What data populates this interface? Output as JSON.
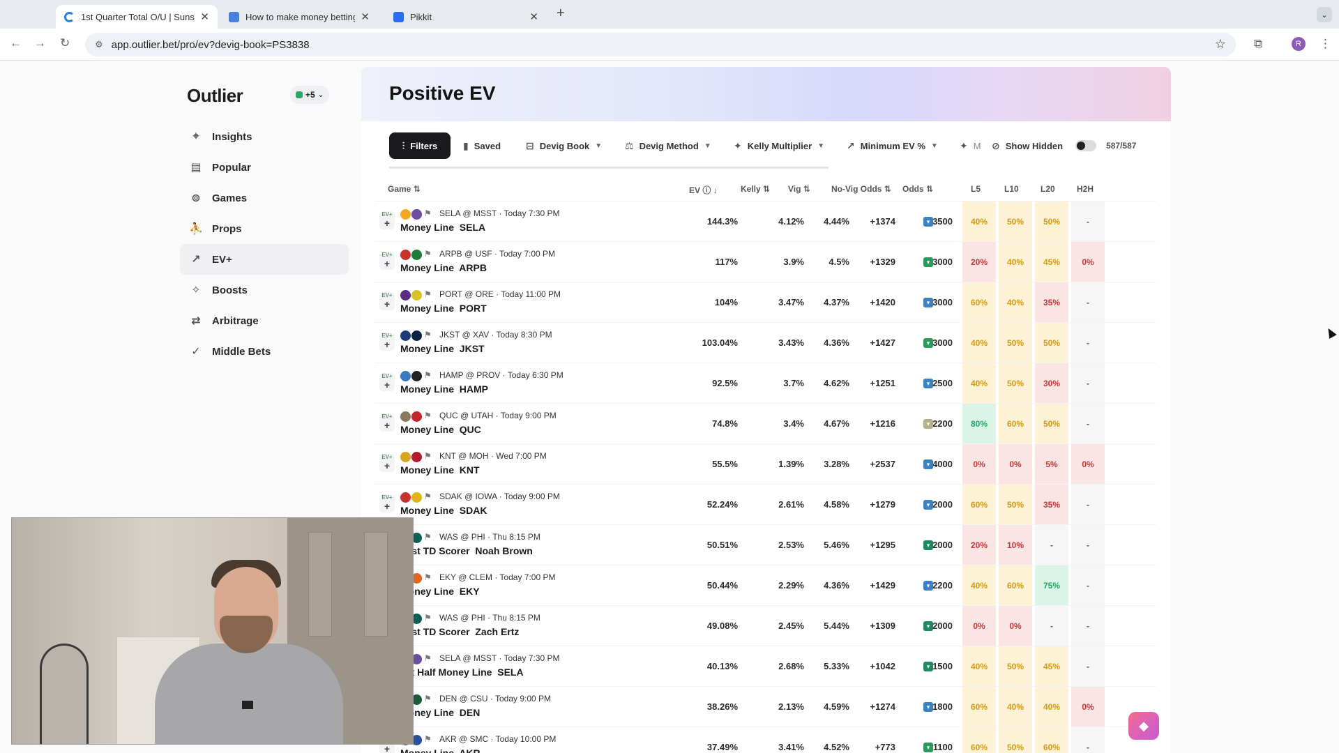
{
  "browser": {
    "tabs": [
      {
        "title": "1st Quarter Total O/U | Suns",
        "icon_color": "#2a7de1",
        "active": true
      },
      {
        "title": "How to make money betting",
        "icon_color": "#4a7fe0",
        "active": false
      },
      {
        "title": "Pikkit",
        "icon_color": "#2b6cf0",
        "active": false
      }
    ],
    "url": "app.outlier.bet/pro/ev?devig-book=PS3838",
    "profile_initial": "R"
  },
  "sidebar": {
    "logo": "Outlier",
    "books_chip": "+5",
    "items": [
      {
        "label": "Insights",
        "icon": "map-pin-icon",
        "glyph": "⌖"
      },
      {
        "label": "Popular",
        "icon": "chart-icon",
        "glyph": "▤"
      },
      {
        "label": "Games",
        "icon": "ball-icon",
        "glyph": "⊚"
      },
      {
        "label": "Props",
        "icon": "player-icon",
        "glyph": "⛹"
      },
      {
        "label": "EV+",
        "icon": "ev-icon",
        "glyph": "↗"
      },
      {
        "label": "Boosts",
        "icon": "rocket-icon",
        "glyph": "✧"
      },
      {
        "label": "Arbitrage",
        "icon": "arbitrage-icon",
        "glyph": "⇄"
      },
      {
        "label": "Middle Bets",
        "icon": "middle-icon",
        "glyph": "✓"
      }
    ]
  },
  "page": {
    "title": "Positive EV",
    "controls": {
      "filters": "Filters",
      "saved": "Saved",
      "devig_book": "Devig Book",
      "devig_method": "Devig Method",
      "kelly": "Kelly Multiplier",
      "min_ev": "Minimum EV %",
      "cut_label": "M",
      "show_hidden": "Show Hidden",
      "count": "587/587"
    },
    "columns": {
      "game": "Game",
      "ev": "EV",
      "kelly": "Kelly",
      "vig": "Vig",
      "novig": "No-Vig Odds",
      "odds": "Odds",
      "l5": "L5",
      "l10": "L10",
      "l20": "L20",
      "h2h": "H2H"
    }
  },
  "rows": [
    {
      "ev_tag": "EV+",
      "matchup": "SELA @ MSST · Today 7:30 PM",
      "market": "Money Line",
      "pick": "SELA",
      "ev": "144.3%",
      "kelly": "4.12%",
      "vig": "4.44%",
      "novig": "+1374",
      "odds": "+3500",
      "book": "#3b82c4",
      "l5": "40%",
      "l10": "50%",
      "l20": "50%",
      "h2h": "-",
      "c1": "#f6a623",
      "c2": "#6b4ea0"
    },
    {
      "ev_tag": "EV+",
      "matchup": "ARPB @ USF · Today 7:00 PM",
      "market": "Money Line",
      "pick": "ARPB",
      "ev": "117%",
      "kelly": "3.9%",
      "vig": "4.5%",
      "novig": "+1329",
      "odds": "+3000",
      "book": "#2a9b5a",
      "l5": "20%",
      "l10": "40%",
      "l20": "45%",
      "h2h": "0%",
      "c1": "#c8322d",
      "c2": "#1f7a3e"
    },
    {
      "ev_tag": "EV+",
      "matchup": "PORT @ ORE · Today 11:00 PM",
      "market": "Money Line",
      "pick": "PORT",
      "ev": "104%",
      "kelly": "3.47%",
      "vig": "4.37%",
      "novig": "+1420",
      "odds": "+3000",
      "book": "#3b82c4",
      "l5": "60%",
      "l10": "40%",
      "l20": "35%",
      "h2h": "-",
      "c1": "#5b2c83",
      "c2": "#d8c22a"
    },
    {
      "ev_tag": "EV+",
      "matchup": "JKST @ XAV · Today 8:30 PM",
      "market": "Money Line",
      "pick": "JKST",
      "ev": "103.04%",
      "kelly": "3.43%",
      "vig": "4.36%",
      "novig": "+1427",
      "odds": "+3000",
      "book": "#2a9b5a",
      "l5": "40%",
      "l10": "50%",
      "l20": "50%",
      "h2h": "-",
      "c1": "#1d3b7a",
      "c2": "#0c2340"
    },
    {
      "ev_tag": "EV+",
      "matchup": "HAMP @ PROV · Today 6:30 PM",
      "market": "Money Line",
      "pick": "HAMP",
      "ev": "92.5%",
      "kelly": "3.7%",
      "vig": "4.62%",
      "novig": "+1251",
      "odds": "+2500",
      "book": "#3b82c4",
      "l5": "40%",
      "l10": "50%",
      "l20": "30%",
      "h2h": "-",
      "c1": "#3a78c2",
      "c2": "#222"
    },
    {
      "ev_tag": "EV+",
      "matchup": "QUC @ UTAH · Today 9:00 PM",
      "market": "Money Line",
      "pick": "QUC",
      "ev": "74.8%",
      "kelly": "3.4%",
      "vig": "4.67%",
      "novig": "+1216",
      "odds": "+2200",
      "book": "#b9b08a",
      "l5": "80%",
      "l10": "60%",
      "l20": "50%",
      "h2h": "-",
      "c1": "#8a7a5a",
      "c2": "#c2272d"
    },
    {
      "ev_tag": "EV+",
      "matchup": "KNT @ MOH · Wed 7:00 PM",
      "market": "Money Line",
      "pick": "KNT",
      "ev": "55.5%",
      "kelly": "1.39%",
      "vig": "3.28%",
      "novig": "+2537",
      "odds": "+4000",
      "book": "#3b82c4",
      "l5": "0%",
      "l10": "0%",
      "l20": "5%",
      "h2h": "0%",
      "c1": "#d8a521",
      "c2": "#b51c2e"
    },
    {
      "ev_tag": "EV+",
      "matchup": "SDAK @ IOWA · Today 9:00 PM",
      "market": "Money Line",
      "pick": "SDAK",
      "ev": "52.24%",
      "kelly": "2.61%",
      "vig": "4.58%",
      "novig": "+1279",
      "odds": "+2000",
      "book": "#3b82c4",
      "l5": "60%",
      "l10": "50%",
      "l20": "35%",
      "h2h": "-",
      "c1": "#c8322d",
      "c2": "#e2b41a"
    },
    {
      "ev_tag": "",
      "matchup": "WAS @ PHI · Thu 8:15 PM",
      "market": "Last TD Scorer",
      "pick": "Noah Brown",
      "ev": "50.51%",
      "kelly": "2.53%",
      "vig": "5.46%",
      "novig": "+1295",
      "odds": "+2000",
      "book": "#1f8a60",
      "l5": "20%",
      "l10": "10%",
      "l20": "-",
      "h2h": "-",
      "c1": "#7a1f2b",
      "c2": "#0b5f55"
    },
    {
      "ev_tag": "EV+",
      "matchup": "EKY @ CLEM · Today 7:00 PM",
      "market": "Money Line",
      "pick": "EKY",
      "ev": "50.44%",
      "kelly": "2.29%",
      "vig": "4.36%",
      "novig": "+1429",
      "odds": "+2200",
      "book": "#3b82c4",
      "l5": "40%",
      "l10": "60%",
      "l20": "75%",
      "h2h": "-",
      "c1": "#7a1f2b",
      "c2": "#e2661c"
    },
    {
      "ev_tag": "",
      "matchup": "WAS @ PHI · Thu 8:15 PM",
      "market": "Last TD Scorer",
      "pick": "Zach Ertz",
      "ev": "49.08%",
      "kelly": "2.45%",
      "vig": "5.44%",
      "novig": "+1309",
      "odds": "+2000",
      "book": "#1f8a60",
      "l5": "0%",
      "l10": "0%",
      "l20": "-",
      "h2h": "-",
      "c1": "#7a1f2b",
      "c2": "#0b5f55"
    },
    {
      "ev_tag": "EV+",
      "matchup": "SELA @ MSST · Today 7:30 PM",
      "market": "1st Half Money Line",
      "pick": "SELA",
      "ev": "40.13%",
      "kelly": "2.68%",
      "vig": "5.33%",
      "novig": "+1042",
      "odds": "+1500",
      "book": "#1f8a60",
      "l5": "40%",
      "l10": "50%",
      "l20": "45%",
      "h2h": "-",
      "c1": "#2a8a5a",
      "c2": "#6b4ea0"
    },
    {
      "ev_tag": "EV+",
      "matchup": "DEN @ CSU · Today 9:00 PM",
      "market": "Money Line",
      "pick": "DEN",
      "ev": "38.26%",
      "kelly": "2.13%",
      "vig": "4.59%",
      "novig": "+1274",
      "odds": "+1800",
      "book": "#3b82c4",
      "l5": "60%",
      "l10": "40%",
      "l20": "40%",
      "h2h": "0%",
      "c1": "#9b1b2e",
      "c2": "#1e5a3a"
    },
    {
      "ev_tag": "EV+",
      "matchup": "AKR @ SMC · Today 10:00 PM",
      "market": "Money Line",
      "pick": "AKR",
      "ev": "37.49%",
      "kelly": "3.41%",
      "vig": "4.52%",
      "novig": "+773",
      "odds": "+1100",
      "book": "#2a9b5a",
      "l5": "60%",
      "l10": "50%",
      "l20": "60%",
      "h2h": "-",
      "c1": "#0f2a5a",
      "c2": "#2b4fa0"
    }
  ],
  "colors": {
    "hist_red_bg": "#fbe4e4",
    "hist_red_fg": "#c93636",
    "hist_amber_bg": "#fdf1d6",
    "hist_amber_fg": "#d69a14",
    "hist_green_bg": "#daf5e7",
    "hist_green_fg": "#23a866",
    "hist_neutral_bg": "#f6f6f7",
    "hist_neutral_fg": "#555555"
  }
}
